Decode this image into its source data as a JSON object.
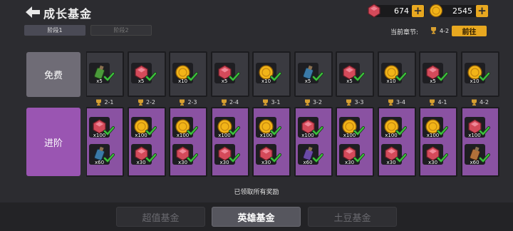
{
  "header": {
    "title": "成长基金"
  },
  "resources": {
    "gems": "674",
    "coins": "2545"
  },
  "stages": {
    "active": "阶段1",
    "inactive": "阶段2"
  },
  "chapter": {
    "label": "当前章节:",
    "value": "4-2",
    "goto": "前往"
  },
  "rows": {
    "free": "免费",
    "advanced": "进阶"
  },
  "columns": [
    {
      "chapter": "2-1",
      "free": {
        "icon": "green-potion-icon",
        "qty": "x5"
      },
      "adv1": {
        "icon": "red-gem-icon",
        "qty": "x100"
      },
      "adv2": {
        "icon": "blue-potion-icon",
        "qty": "x60"
      }
    },
    {
      "chapter": "2-2",
      "free": {
        "icon": "red-gem-icon",
        "qty": "x5"
      },
      "adv1": {
        "icon": "gold-coin-icon",
        "qty": "x100"
      },
      "adv2": {
        "icon": "red-gem-icon",
        "qty": "x30"
      }
    },
    {
      "chapter": "2-3",
      "free": {
        "icon": "gold-coin-icon",
        "qty": "x10"
      },
      "adv1": {
        "icon": "gold-coin-icon",
        "qty": "x100"
      },
      "adv2": {
        "icon": "red-gem-icon",
        "qty": "x30"
      }
    },
    {
      "chapter": "2-4",
      "free": {
        "icon": "red-gem-icon",
        "qty": "x5"
      },
      "adv1": {
        "icon": "gold-coin-icon",
        "qty": "x100"
      },
      "adv2": {
        "icon": "red-gem-icon",
        "qty": "x30"
      }
    },
    {
      "chapter": "3-1",
      "free": {
        "icon": "gold-coin-icon",
        "qty": "x10"
      },
      "adv1": {
        "icon": "gold-coin-icon",
        "qty": "x100"
      },
      "adv2": {
        "icon": "red-gem-icon",
        "qty": "x30"
      }
    },
    {
      "chapter": "3-2",
      "free": {
        "icon": "blue-potion-icon",
        "qty": "x5"
      },
      "adv1": {
        "icon": "red-gem-icon",
        "qty": "x100"
      },
      "adv2": {
        "icon": "purple-potion-icon",
        "qty": "x60"
      }
    },
    {
      "chapter": "3-3",
      "free": {
        "icon": "red-gem-icon",
        "qty": "x5"
      },
      "adv1": {
        "icon": "gold-coin-icon",
        "qty": "x100"
      },
      "adv2": {
        "icon": "red-gem-icon",
        "qty": "x30"
      }
    },
    {
      "chapter": "3-4",
      "free": {
        "icon": "gold-coin-icon",
        "qty": "x10"
      },
      "adv1": {
        "icon": "gold-coin-icon",
        "qty": "x100"
      },
      "adv2": {
        "icon": "red-gem-icon",
        "qty": "x30"
      }
    },
    {
      "chapter": "4-1",
      "free": {
        "icon": "red-gem-icon",
        "qty": "x5"
      },
      "adv1": {
        "icon": "gold-coin-icon",
        "qty": "x100"
      },
      "adv2": {
        "icon": "red-gem-icon",
        "qty": "x30"
      }
    },
    {
      "chapter": "4-2",
      "free": {
        "icon": "gold-coin-icon",
        "qty": "x10"
      },
      "adv1": {
        "icon": "red-gem-icon",
        "qty": "x100"
      },
      "adv2": {
        "icon": "orange-potion-icon",
        "qty": "x60"
      }
    }
  ],
  "status": "已领取所有奖励",
  "fund_tabs": {
    "tab1": "超值基金",
    "tab2": "英雄基金",
    "tab3": "土豆基金"
  },
  "colors": {
    "accent": "#e8a820",
    "advanced": "#8a52a2",
    "check": "#3cc03c"
  }
}
